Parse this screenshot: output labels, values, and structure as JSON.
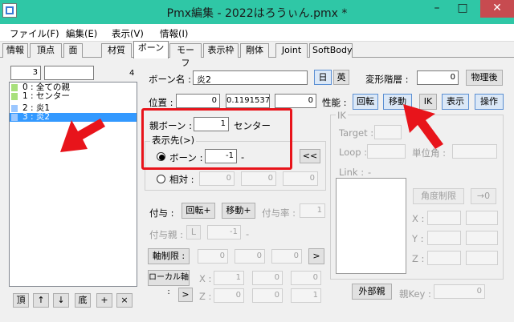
{
  "window": {
    "title": "Pmx編集 - 2022はろうぃん.pmx *",
    "min_icon": "minimize-icon",
    "max_icon": "maximize-icon",
    "close_icon": "close-icon"
  },
  "menus": [
    "ファイル(F)",
    "編集(E)",
    "表示(V)",
    "情報(I)"
  ],
  "tabs": [
    "情報",
    "頂点",
    "面",
    "材質",
    "ボーン",
    "モーフ",
    "表示枠",
    "剛体",
    "Joint",
    "SoftBody"
  ],
  "active_tab": "ボーン",
  "left": {
    "index_value": "3",
    "count": "4",
    "bones": [
      {
        "label": "0 : 全ての親",
        "color": "#a8e07c"
      },
      {
        "label": "1 : センター",
        "color": "#a8e07c"
      },
      {
        "label": "2 : 炎1",
        "color": "#9bc7ff"
      },
      {
        "label": "3 : 炎2",
        "color": "#9bc7ff"
      }
    ],
    "selected_index": 3,
    "bottom_buttons": [
      "頂",
      "↑",
      "↓",
      "底",
      "+",
      "×"
    ]
  },
  "bone": {
    "name_label": "ボーン名 :",
    "name_value": "炎2",
    "lang_jp": "日",
    "lang_en": "英",
    "layer_label": "変形階層 :",
    "layer_value": "0",
    "after_physics": "物理後",
    "position_label": "位置 :",
    "position": [
      "0",
      "0.1191537",
      "0"
    ],
    "perf_label": "性能 :",
    "perf_buttons": [
      "回転",
      "移動",
      "IK",
      "表示",
      "操作"
    ],
    "parent_label": "親ボーン :",
    "parent_value": "1",
    "parent_name": "センター",
    "dest_label": "表示先(>)",
    "dest_bone_label": "ボーン :",
    "dest_bone_value": "-1",
    "dest_dash": "-",
    "dest_relative_label": "相対 :",
    "relative_values": [
      "0",
      "0",
      "0"
    ],
    "collapse_btn": "<<",
    "grant_label": "付与 :",
    "grant_rot": "回転+",
    "grant_move": "移動+",
    "grant_rate_label": "付与率 :",
    "grant_rate_value": "1",
    "grant_parent_label": "付与親 :",
    "grant_parent_l": "L",
    "grant_parent_value": "-1",
    "grant_parent_dash": "-",
    "axis_limit": "軸制限 :",
    "axis_values": [
      "0",
      "0",
      "0"
    ],
    "axis_arrow": ">",
    "local_axis": "ローカル軸 :",
    "local_x": "X :",
    "local_z": "Z :",
    "local_x_values": [
      "1",
      "0",
      "0"
    ],
    "local_z_values": [
      "0",
      "0",
      "1"
    ],
    "local_arrow": ">"
  },
  "ik": {
    "title": "IK",
    "target": "Target :",
    "loop": "Loop :",
    "unit_angle": "単位角 :",
    "link": "Link :",
    "link_dash": "-",
    "angle_limit": "角度制限",
    "zero_btn": "→0",
    "x": "X :",
    "y": "Y :",
    "z": "Z :"
  },
  "external": {
    "btn": "外部親",
    "key_label": "親Key :",
    "key_value": "0"
  },
  "colors": {
    "title_bar": "#2fc7a6",
    "annotation_red": "#e8141b",
    "selection": "#3399ff"
  }
}
